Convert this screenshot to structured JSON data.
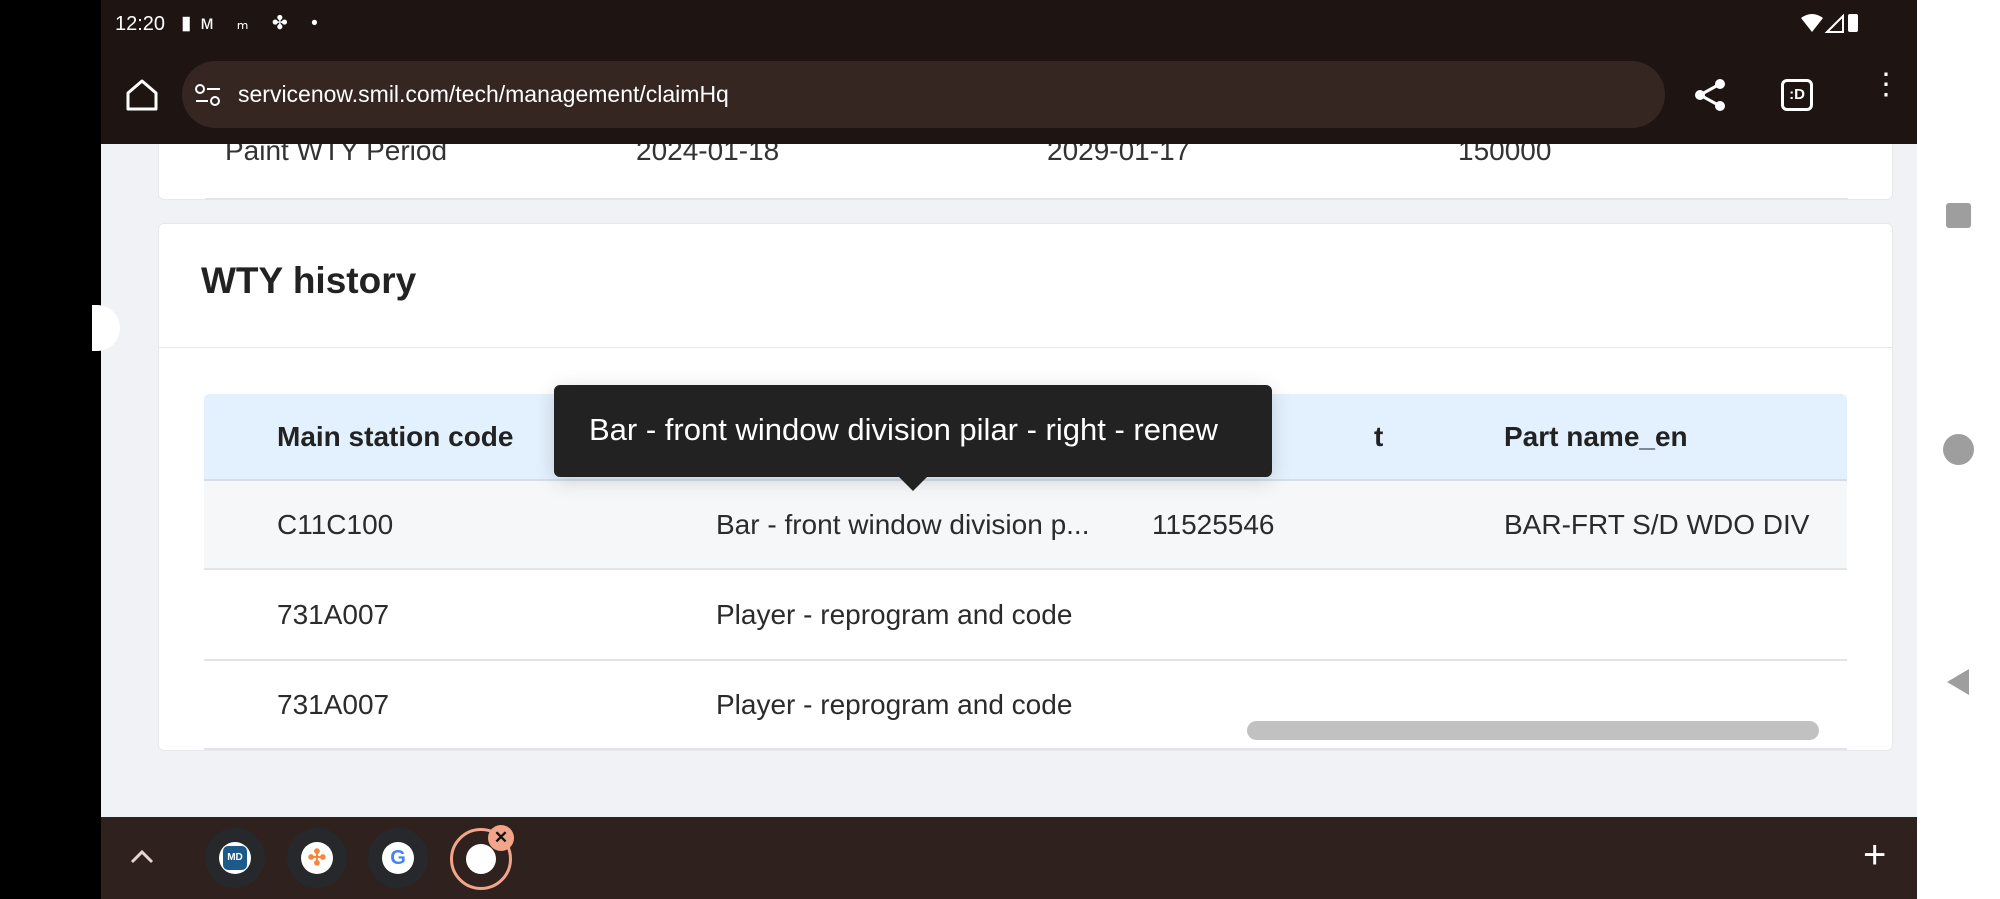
{
  "status_bar": {
    "time": "12:20",
    "notification_icons": [
      "battery-saver-icon",
      "gmail-icon",
      "mcdonalds-icon",
      "pinwheel-icon",
      "dot-icon"
    ],
    "system_icons": [
      "wifi-icon",
      "signal-icon",
      "battery-icon"
    ]
  },
  "browser": {
    "url": "servicenow.smil.com/tech/management/claimHq",
    "tab_count_label": ":D"
  },
  "prev_card": {
    "row": [
      "Paint WTY Period",
      "2024-01-18",
      "2029-01-17",
      "150000"
    ]
  },
  "wty_history": {
    "title": "WTY history",
    "headers": [
      "Main station code",
      "",
      "t",
      "Part name_en"
    ],
    "rows": [
      [
        "C11C100",
        "Bar - front window division p...",
        "11525546",
        "BAR-FRT S/D WDO DIV"
      ],
      [
        "731A007",
        "Player - reprogram and code",
        "",
        ""
      ],
      [
        "731A007",
        "Player - reprogram and code",
        "",
        ""
      ]
    ],
    "tooltip": "Bar - front window division pilar - right - renew"
  },
  "taskbar": {
    "apps": [
      "md-chat-app",
      "orange-app",
      "google-app",
      "active-app"
    ],
    "close_label": "✕",
    "plus_label": "+"
  },
  "colors": {
    "chrome": "#1e1412",
    "taskbar": "#2e211e",
    "table_header": "#e3f0fd",
    "tooltip": "#222222"
  }
}
